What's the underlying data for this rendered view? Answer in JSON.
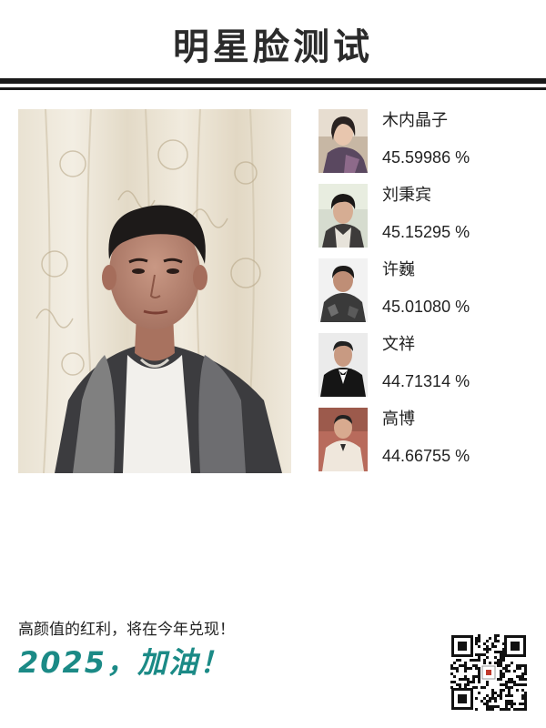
{
  "header": {
    "title": "明星脸测试"
  },
  "results": [
    {
      "name": "木内晶子",
      "score": "45.59986 %"
    },
    {
      "name": "刘秉宾",
      "score": "45.15295 %"
    },
    {
      "name": "许巍",
      "score": "45.01080 %"
    },
    {
      "name": "文祥",
      "score": "44.71314 %"
    },
    {
      "name": "高博",
      "score": "44.66755 %"
    }
  ],
  "footer": {
    "tagline": "高颜值的红利，将在今年兑现！",
    "slogan": "2025，加油！"
  },
  "colors": {
    "accent": "#1b8a86",
    "rule": "#1a1a1a"
  },
  "icons": {
    "qr_code": "qr-code-icon"
  }
}
